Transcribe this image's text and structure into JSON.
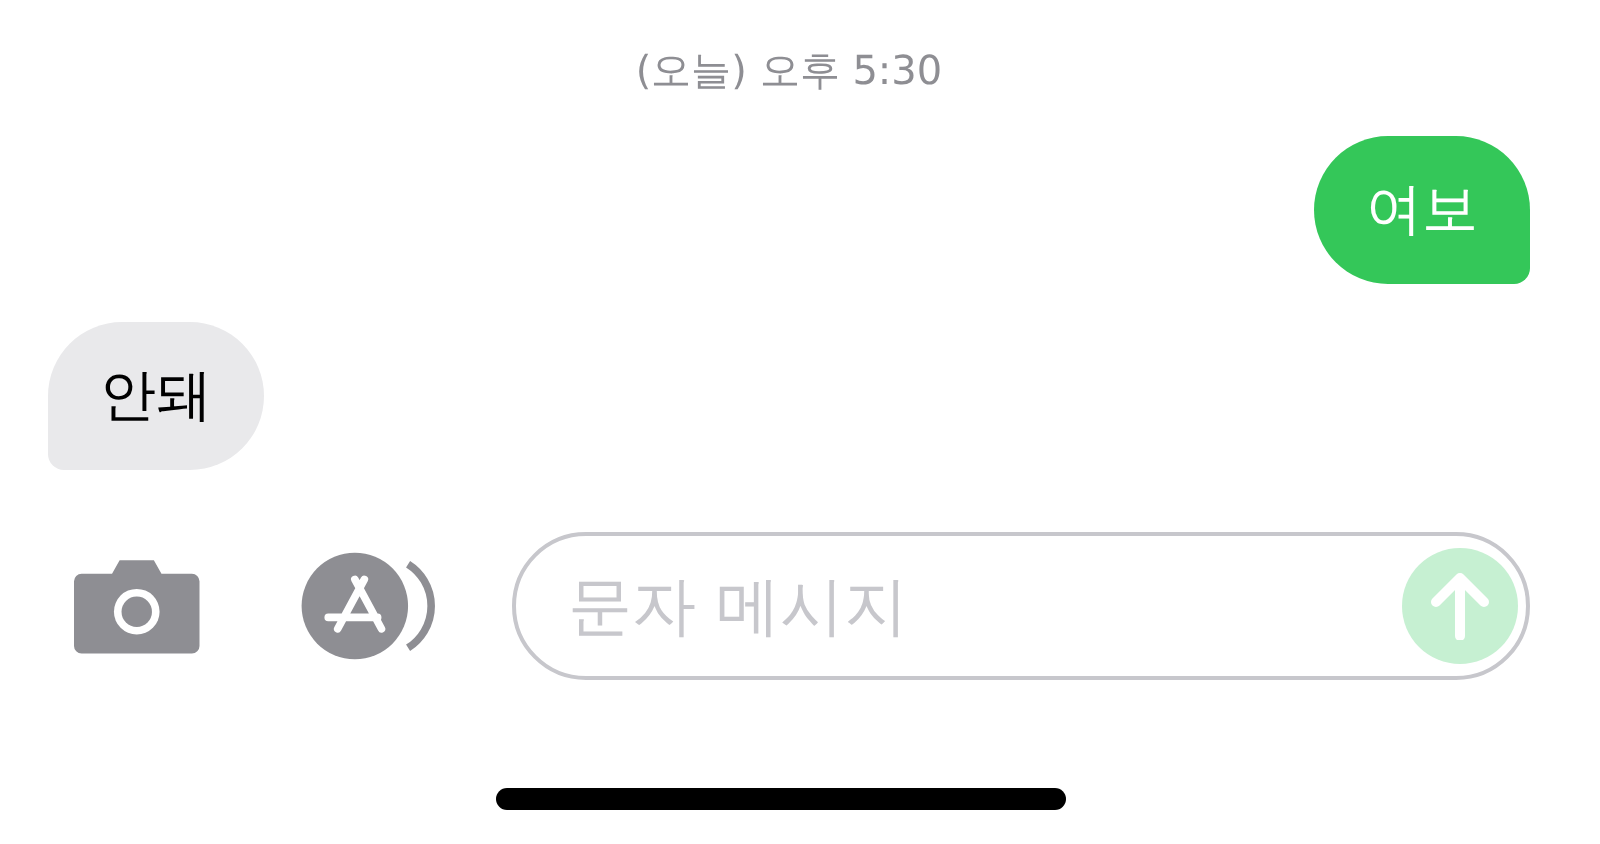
{
  "timestamp": "(오늘) 오후 5:30",
  "messages": [
    {
      "text": "여보",
      "kind": "sent"
    },
    {
      "text": "안돼",
      "kind": "received"
    }
  ],
  "composer": {
    "placeholder": "문자 메시지",
    "send_disabled": true
  }
}
